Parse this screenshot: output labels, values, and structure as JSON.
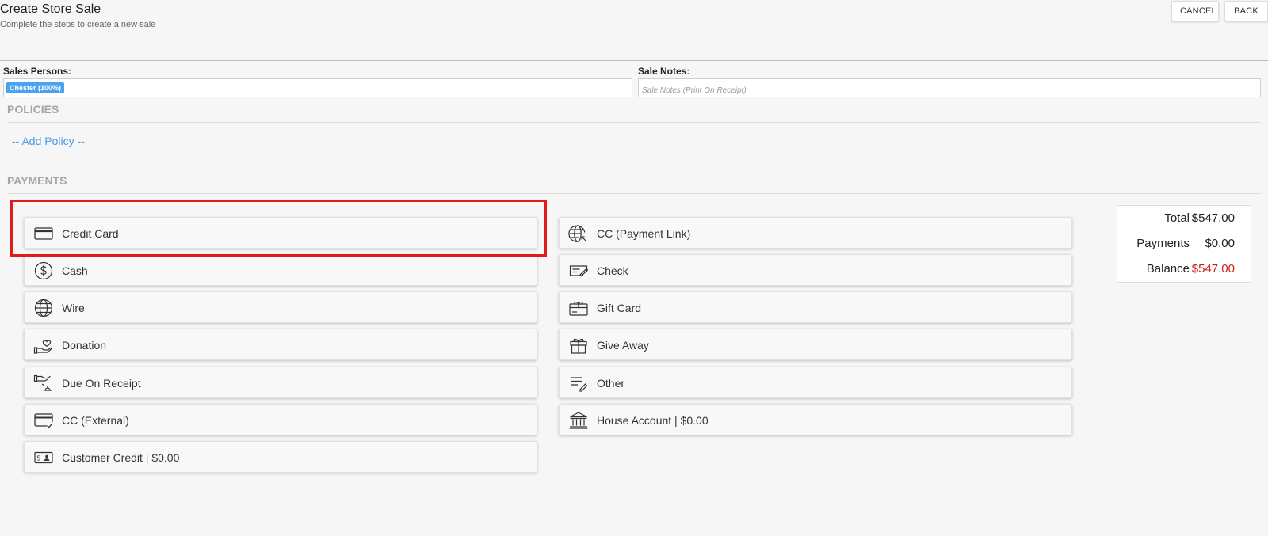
{
  "header": {
    "title": "Create Store Sale",
    "subtitle": "Complete the steps to create a new sale",
    "cancel_label": "CANCEL",
    "back_label": "BACK"
  },
  "sales_persons": {
    "label": "Sales Persons:",
    "chip": "Chester (100%)"
  },
  "sale_notes": {
    "label": "Sale Notes:",
    "placeholder": "Sale Notes (Print On Receipt)",
    "value": ""
  },
  "policies": {
    "title": "POLICIES",
    "add_label": "-- Add Policy --"
  },
  "payments": {
    "title": "PAYMENTS",
    "left": [
      {
        "label": "Credit Card",
        "icon": "credit-card-icon"
      },
      {
        "label": "Cash",
        "icon": "dollar-coin-icon"
      },
      {
        "label": "Wire",
        "icon": "globe-icon"
      },
      {
        "label": "Donation",
        "icon": "heart-hand-icon"
      },
      {
        "label": "Due On Receipt",
        "icon": "hand-receipt-icon"
      },
      {
        "label": "CC (External)",
        "icon": "card-check-icon"
      },
      {
        "label": "Customer Credit | $0.00",
        "icon": "credit-id-icon"
      }
    ],
    "right": [
      {
        "label": "CC (Payment Link)",
        "icon": "globe-link-icon"
      },
      {
        "label": "Check",
        "icon": "check-pen-icon"
      },
      {
        "label": "Gift Card",
        "icon": "gift-card-icon"
      },
      {
        "label": "Give Away",
        "icon": "gift-box-icon"
      },
      {
        "label": "Other",
        "icon": "list-pen-icon"
      },
      {
        "label": "House Account | $0.00",
        "icon": "bank-icon"
      }
    ]
  },
  "totals": {
    "total_label": "Total",
    "total_value": "$547.00",
    "payments_label": "Payments",
    "payments_value": "$0.00",
    "balance_label": "Balance",
    "balance_value": "$547.00"
  },
  "colors": {
    "accent": "#4a9ae8",
    "chip": "#4aa3f0",
    "balance": "#d0201b",
    "highlight": "#e01b1b"
  }
}
